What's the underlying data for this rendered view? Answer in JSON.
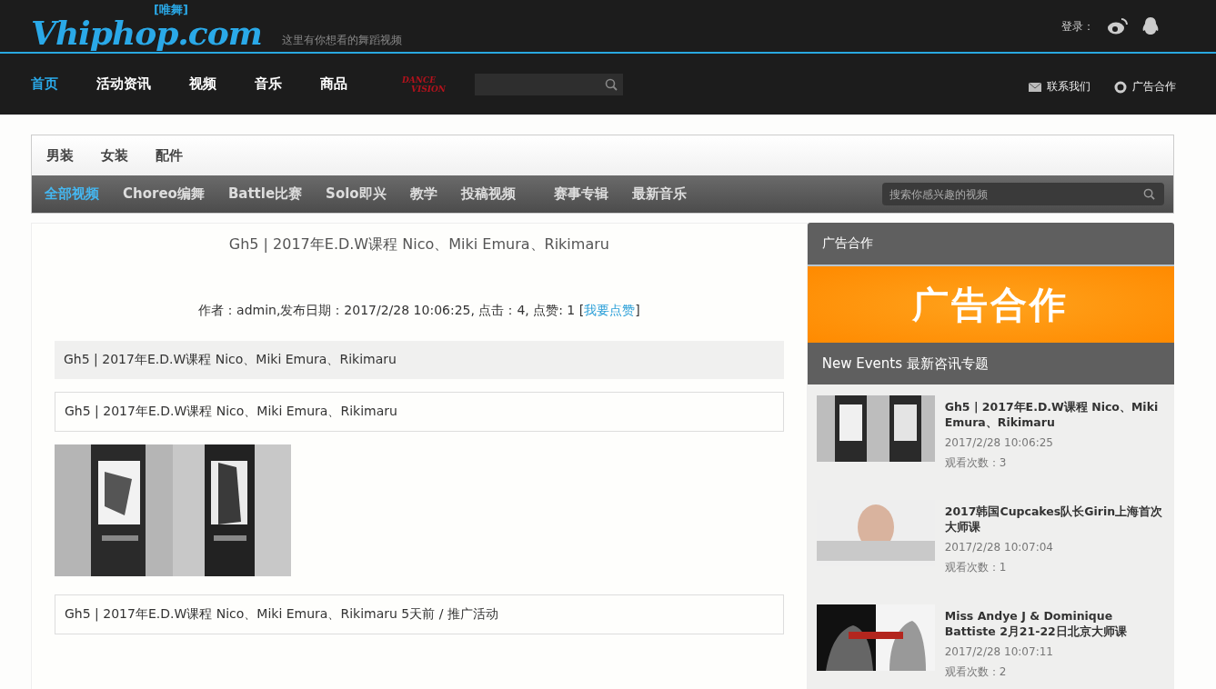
{
  "header": {
    "logo_main": "Vhiphop.com",
    "logo_tag": "[唯舞]",
    "slogan": "这里有你想看的舞蹈视频",
    "login_label": "登录：",
    "dance_logo": [
      "DANCE",
      "VISION"
    ]
  },
  "main_nav": [
    {
      "label": "首页",
      "selected": true
    },
    {
      "label": "活动资讯",
      "selected": false
    },
    {
      "label": "视频",
      "selected": false
    },
    {
      "label": "音乐",
      "selected": false
    },
    {
      "label": "商品",
      "selected": false
    }
  ],
  "utility_links": [
    {
      "kind": "mail",
      "label": "联系我们"
    },
    {
      "kind": "ring",
      "label": "广告合作"
    }
  ],
  "shop_tabs": [
    "男装",
    "女装",
    "配件"
  ],
  "video_tabs": [
    {
      "label": "全部视频",
      "selected": true
    },
    {
      "label": "Choreo编舞",
      "selected": false
    },
    {
      "label": "Battle比赛",
      "selected": false
    },
    {
      "label": "Solo即兴",
      "selected": false
    },
    {
      "label": "教学",
      "selected": false
    },
    {
      "label": "投稿视频",
      "selected": false
    },
    {
      "label": "赛事专辑",
      "selected": false
    },
    {
      "label": "最新音乐",
      "selected": false
    }
  ],
  "video_search": {
    "placeholder": "搜索你感兴趣的视频"
  },
  "article": {
    "title": "Gh5 | 2017年E.D.W课程 Nico、Miki Emura、Rikimaru",
    "meta": "作者：admin,发布日期：2017/2/28 10:06:25, 点击：4, 点赞: 1 [",
    "like_link": "我要点赞",
    "meta_end": "]",
    "blocks": [
      {
        "kind": "shaded",
        "text": "Gh5 | 2017年E.D.W课程 Nico、Miki Emura、Rikimaru"
      },
      {
        "kind": "bordered",
        "text": "Gh5 | 2017年E.D.W课程 Nico、Miki Emura、Rikimaru"
      },
      {
        "kind": "picture"
      },
      {
        "kind": "bordered",
        "text": "Gh5 | 2017年E.D.W课程 Nico、Miki Emura、Rikimaru 5天前 / 推广活动"
      }
    ]
  },
  "sidebar": {
    "ad_heading": "广告合作",
    "ad_banner": "广告合作",
    "events_heading": "New Events 最新咨讯专题",
    "events": [
      {
        "title": "Gh5 | 2017年E.D.W课程 Nico、Miki Emura、Rikimaru",
        "date": "2017/2/28 10:06:25",
        "views": "观看次数：3"
      },
      {
        "title": "2017韩国Cupcakes队长Girin上海首次大师课",
        "date": "2017/2/28 10:07:04",
        "views": "观看次数：1"
      },
      {
        "title": "Miss Andye J & Dominique Battiste 2月21-22日北京大师课",
        "date": "2017/2/28 10:07:11",
        "views": "观看次数：2"
      }
    ]
  }
}
